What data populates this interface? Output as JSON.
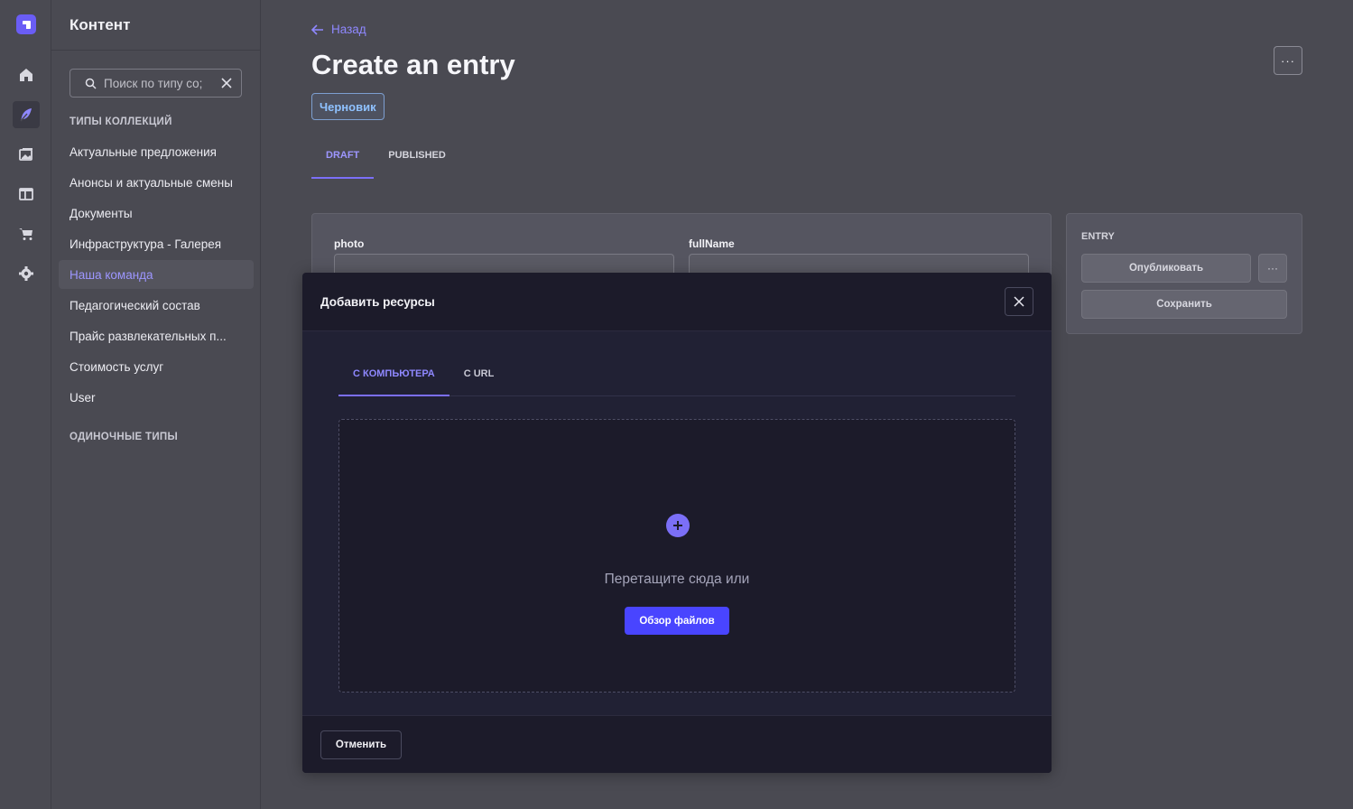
{
  "sidebar": {
    "title": "Контент",
    "search_placeholder": "Поиск по типу со;",
    "collection_types_label": "ТИПЫ КОЛЛЕКЦИЙ",
    "items": [
      {
        "label": "Актуальные предложения"
      },
      {
        "label": "Анонсы и актуальные смены"
      },
      {
        "label": "Документы"
      },
      {
        "label": "Инфраструктура - Галерея"
      },
      {
        "label": "Наша команда"
      },
      {
        "label": "Педагогический состав"
      },
      {
        "label": "Прайс развлекательных п..."
      },
      {
        "label": "Стоимость услуг"
      },
      {
        "label": "User"
      }
    ],
    "single_types_label": "ОДИНОЧНЫЕ ТИПЫ"
  },
  "header": {
    "back_label": "Назад",
    "title": "Create an entry",
    "status_badge": "Черновик",
    "more_label": "···"
  },
  "tabs": [
    "DRAFT",
    "PUBLISHED"
  ],
  "form": {
    "fields": [
      {
        "label": "photo"
      },
      {
        "label": "fullName"
      }
    ]
  },
  "entry_panel": {
    "title": "ENTRY",
    "publish_label": "Опубликовать",
    "more_label": "···",
    "save_label": "Сохранить"
  },
  "modal": {
    "title": "Добавить ресурсы",
    "tabs": [
      "С КОМПЬЮТЕРА",
      "С URL"
    ],
    "drop_hint": "Перетащите сюда или",
    "browse_label": "Обзор файлов",
    "cancel_label": "Отменить"
  },
  "colors": {
    "accent": "#7b6ff7",
    "primary_button": "#4945ff",
    "modal_bg": "#1c1b2a",
    "badge_text": "#8fc2ff"
  }
}
